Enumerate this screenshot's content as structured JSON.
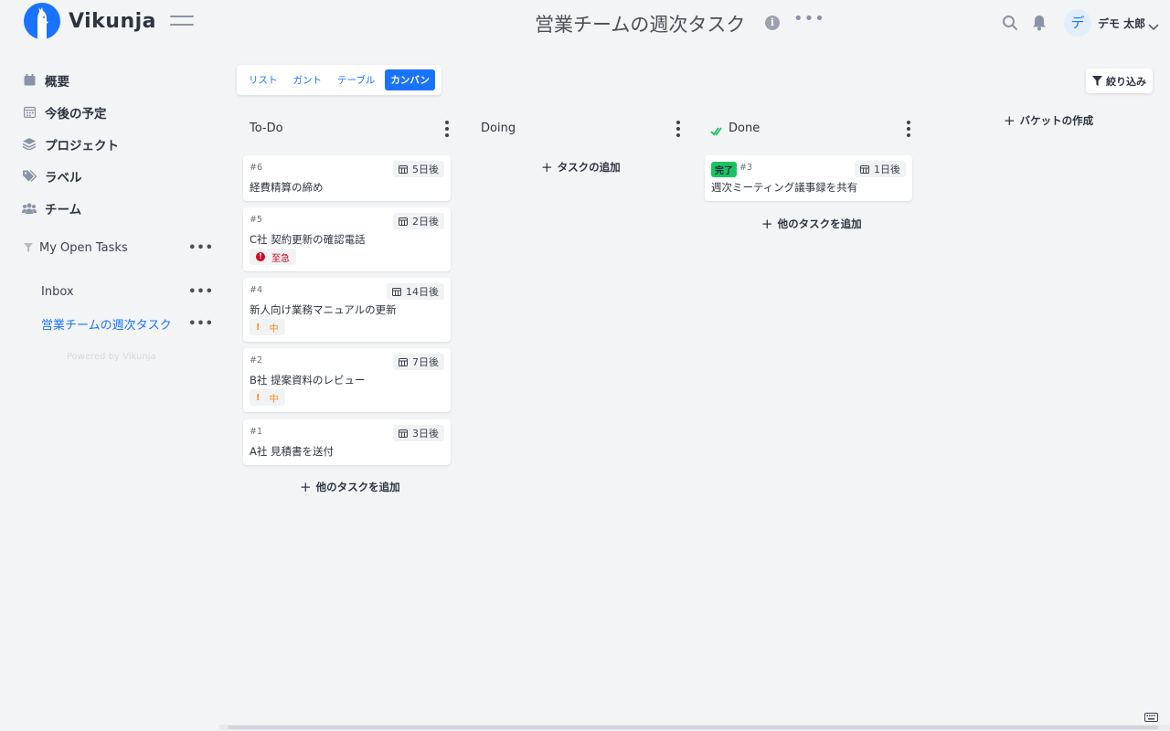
{
  "app": {
    "name": "Vikunja"
  },
  "header": {
    "project_title": "営業チームの週次タスク",
    "info_glyph": "i",
    "more_glyph": "•••",
    "user": {
      "avatar_initial": "デ",
      "name": "デモ 太郎"
    }
  },
  "sidebar": {
    "nav": [
      {
        "label": "概要",
        "icon": "calendar-icon"
      },
      {
        "label": "今後の予定",
        "icon": "calendar-grid-icon"
      },
      {
        "label": "プロジェクト",
        "icon": "layers-icon"
      },
      {
        "label": "ラベル",
        "icon": "tags-icon"
      },
      {
        "label": "チーム",
        "icon": "users-icon"
      }
    ],
    "saved_filter": {
      "label": "My Open Tasks"
    },
    "projects": [
      {
        "label": "Inbox"
      },
      {
        "label": "営業チームの週次タスク",
        "active": true
      }
    ],
    "powered_by": "Powered by Vikunja"
  },
  "views": {
    "list": "リスト",
    "gantt": "ガント",
    "table": "テーブル",
    "kanban": "カンバン",
    "active": "kanban"
  },
  "filter_label": "絞り込み",
  "buckets": [
    {
      "title": "To-Do",
      "add_label": "他のタスクを追加",
      "cards": [
        {
          "id": "#6",
          "due": "5日後",
          "title": "経費精算の締め"
        },
        {
          "id": "#5",
          "due": "2日後",
          "title": "C社 契約更新の確認電話",
          "priority": "至急",
          "priority_level": "urgent"
        },
        {
          "id": "#4",
          "due": "14日後",
          "title": "新人向け業務マニュアルの更新",
          "priority": "中",
          "priority_level": "medium"
        },
        {
          "id": "#2",
          "due": "7日後",
          "title": "B社 提案資料のレビュー",
          "priority": "中",
          "priority_level": "medium"
        },
        {
          "id": "#1",
          "due": "3日後",
          "title": "A社 見積書を送付"
        }
      ]
    },
    {
      "title": "Doing",
      "add_label": "タスクの追加",
      "cards": []
    },
    {
      "title": "Done",
      "add_label": "他のタスクを追加",
      "cards": [
        {
          "id": "#3",
          "due": "1日後",
          "title": "週次ミーティング議事録を共有",
          "done_label": "完了"
        }
      ]
    }
  ],
  "create_bucket_label": "バケットの作成",
  "colors": {
    "primary": "#1973ff",
    "background": "#f3f4f6",
    "urgent": "#d6001c",
    "medium": "#ff851b",
    "done": "#1ac364"
  }
}
